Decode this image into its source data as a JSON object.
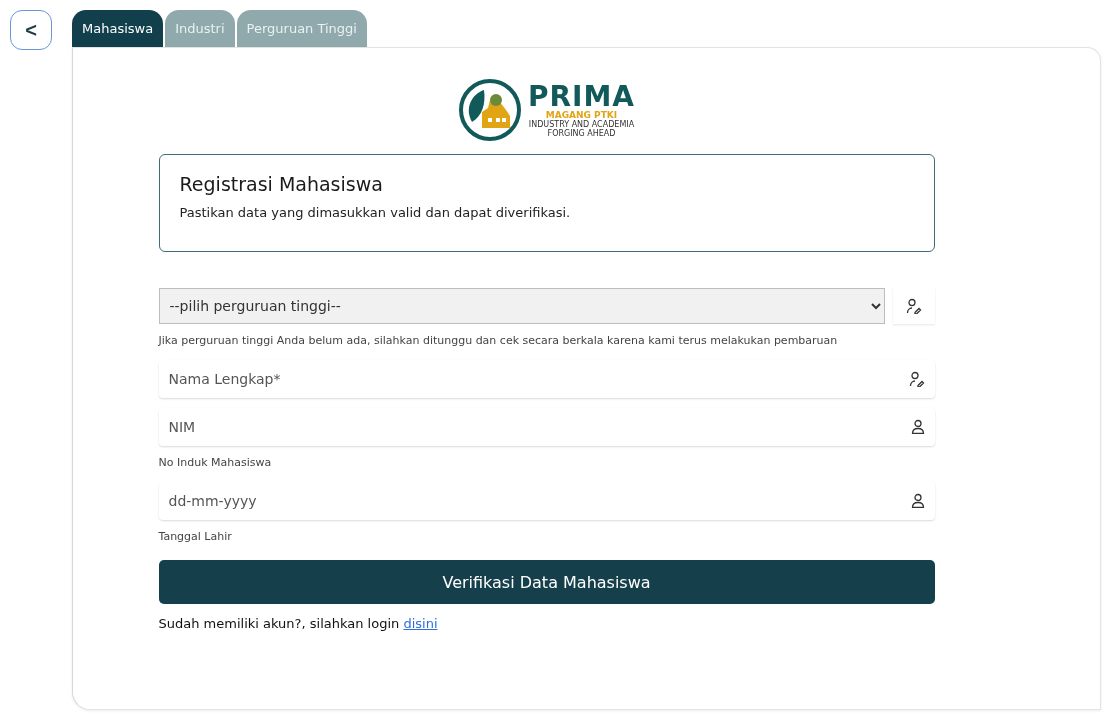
{
  "back_button": {
    "label": "<"
  },
  "tabs": [
    {
      "label": "Mahasiswa",
      "selected": true
    },
    {
      "label": "Industri",
      "selected": false
    },
    {
      "label": "Perguruan Tinggi",
      "selected": false
    }
  ],
  "logo": {
    "title": "PRIMA",
    "subtitle": "MAGANG PTKI",
    "tagline_1": "INDUSTRY AND ACADEMIA",
    "tagline_2": "FORGING AHEAD"
  },
  "intro": {
    "title": "Registrasi Mahasiswa",
    "text": "Pastikan data yang dimasukkan valid dan dapat diverifikasi."
  },
  "fields": [
    {
      "kind": "select",
      "placeholder": "--pilih perguruan tinggi--",
      "hint": "Jika perguruan tinggi Anda belum ada, silahkan ditunggu dan cek secara berkala karena kami terus melakukan pembaruan"
    },
    {
      "kind": "text",
      "placeholder": "Nama Lengkap*"
    },
    {
      "kind": "text",
      "placeholder": "NIM",
      "hint": "No Induk Mahasiswa"
    },
    {
      "kind": "text",
      "placeholder": "dd-mm-yyyy",
      "hint": "Tanggal Lahir"
    }
  ],
  "submit_button": {
    "label": "Verifikasi Data Mahasiswa"
  },
  "login": {
    "text": "Sudah memiliki akun?, silahkan login",
    "link": "disini"
  }
}
